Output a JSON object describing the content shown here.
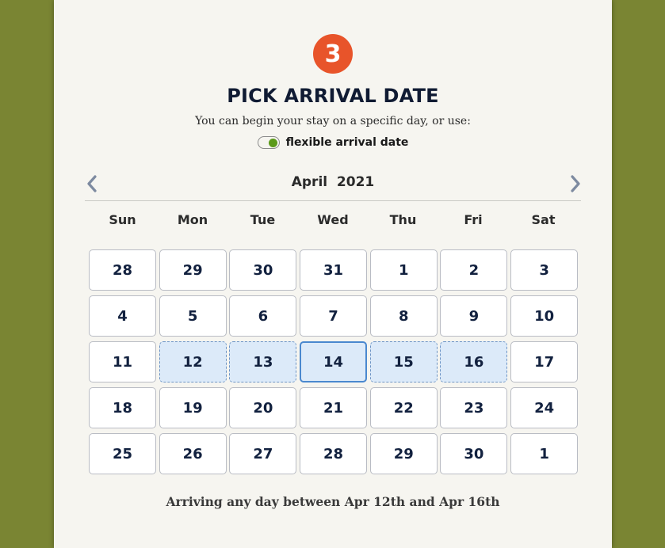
{
  "step": {
    "number": "3"
  },
  "header": {
    "title": "PICK ARRIVAL DATE",
    "subtitle": "You can begin your stay on a specific day, or use:"
  },
  "flexible": {
    "label": "flexible arrival date",
    "enabled": true
  },
  "calendar": {
    "month_label": "April  2021",
    "prev_icon": "chevron-left-icon",
    "next_icon": "chevron-right-icon",
    "weekdays": [
      "Sun",
      "Mon",
      "Tue",
      "Wed",
      "Thu",
      "Fri",
      "Sat"
    ],
    "days": [
      {
        "label": "28",
        "state": "normal"
      },
      {
        "label": "29",
        "state": "normal"
      },
      {
        "label": "30",
        "state": "normal"
      },
      {
        "label": "31",
        "state": "normal"
      },
      {
        "label": "1",
        "state": "normal"
      },
      {
        "label": "2",
        "state": "normal"
      },
      {
        "label": "3",
        "state": "normal"
      },
      {
        "label": "4",
        "state": "normal"
      },
      {
        "label": "5",
        "state": "normal"
      },
      {
        "label": "6",
        "state": "normal"
      },
      {
        "label": "7",
        "state": "normal"
      },
      {
        "label": "8",
        "state": "normal"
      },
      {
        "label": "9",
        "state": "normal"
      },
      {
        "label": "10",
        "state": "normal"
      },
      {
        "label": "11",
        "state": "normal"
      },
      {
        "label": "12",
        "state": "range"
      },
      {
        "label": "13",
        "state": "range"
      },
      {
        "label": "14",
        "state": "selected"
      },
      {
        "label": "15",
        "state": "range"
      },
      {
        "label": "16",
        "state": "range"
      },
      {
        "label": "17",
        "state": "normal"
      },
      {
        "label": "18",
        "state": "normal"
      },
      {
        "label": "19",
        "state": "normal"
      },
      {
        "label": "20",
        "state": "normal"
      },
      {
        "label": "21",
        "state": "normal"
      },
      {
        "label": "22",
        "state": "normal"
      },
      {
        "label": "23",
        "state": "normal"
      },
      {
        "label": "24",
        "state": "normal"
      },
      {
        "label": "25",
        "state": "normal"
      },
      {
        "label": "26",
        "state": "normal"
      },
      {
        "label": "27",
        "state": "normal"
      },
      {
        "label": "28",
        "state": "normal"
      },
      {
        "label": "29",
        "state": "normal"
      },
      {
        "label": "30",
        "state": "normal"
      },
      {
        "label": "1",
        "state": "normal"
      }
    ]
  },
  "footer": {
    "text": "Arriving any day between Apr 12th and Apr 16th"
  },
  "colors": {
    "page_bg": "#7a8533",
    "step_badge": "#e8542a",
    "toggle_on": "#5c9a1a",
    "range_fill": "#dceaf9",
    "selected_border": "#4a88cf"
  }
}
